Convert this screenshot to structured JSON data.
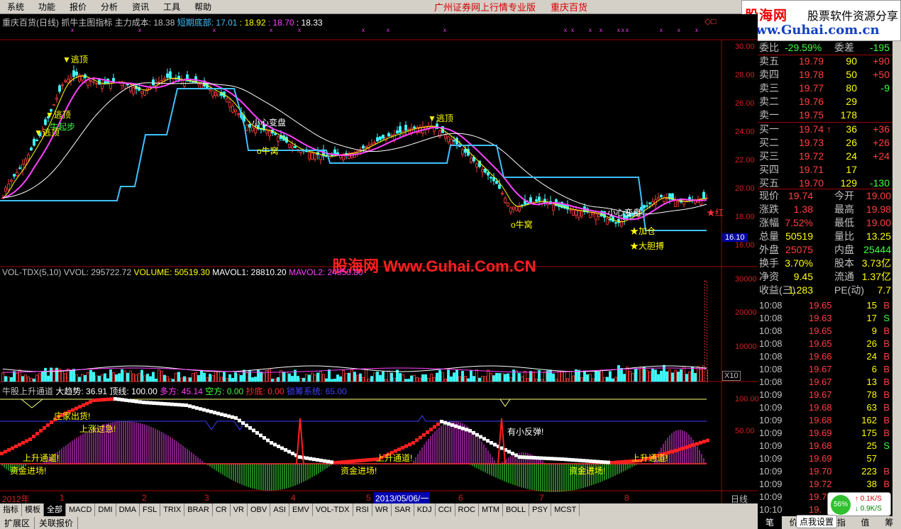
{
  "menu": {
    "items": [
      "系统",
      "功能",
      "报价",
      "分析",
      "资讯",
      "工具",
      "帮助"
    ],
    "promo": "广州证券网上行情专业版",
    "stock_name": "重庆百货"
  },
  "logo": {
    "name": "股海网",
    "slogan": "股票软件资源分享",
    "url": "www.Guhai.com.cn"
  },
  "main_title": {
    "stock": "重庆百货(日线)",
    "indicator": "抓牛主图指标",
    "cost_label": "主力成本: 18.38",
    "bottom_label": "短期底部: 17.01",
    "v1": ": 18.92",
    "v2": ": 18.70",
    "v3": ": 18.33"
  },
  "main_axis": [
    "30.00",
    "28.00",
    "26.00",
    "24.00",
    "22.00",
    "20.00",
    "18.00",
    "16.00"
  ],
  "price_tag": "16.10",
  "annotations": {
    "escape": "逃顶",
    "start": "牛起步",
    "nest": "o牛窝",
    "caution": "小心变盘",
    "add": "★加仓",
    "bold": "★大胆搏",
    "red": "红"
  },
  "watermark": "股海网 Www.Guhai.Com.CN",
  "vol_title": {
    "name": "VOL-TDX(5,10)",
    "vvol": "VVOL: 295722.72",
    "volume": "VOLUME: 50519.30",
    "mavol1": "MAVOL1: 28810.20",
    "mavol2": "MAVOL2: 24850.80"
  },
  "vol_axis": [
    "30000",
    "20000",
    "10000"
  ],
  "vol_unit": "X10",
  "ind_title": {
    "name": "牛股上升通道",
    "trend": "大趋势: 36.91",
    "top": "顶线: 100.00",
    "long": "多方: 45.14",
    "short": "空方: 0.00",
    "bottom": "抄底: 0.00",
    "lock": "锁筹系统: 65.00"
  },
  "ind_axis": [
    "100.00",
    "50.00"
  ],
  "ind_labels": {
    "dump": "庄家出货!",
    "rise_fast": "上涨过急!",
    "channel": "上升通道!",
    "inflow": "资金进场!",
    "rebound": "有小反弹!"
  },
  "xaxis": {
    "year": "2012年",
    "months": [
      "1",
      "2",
      "3",
      "4",
      "5",
      "6",
      "7",
      "8"
    ],
    "date": "2013/05/06/一",
    "period": "日线"
  },
  "quote": {
    "wb_label": "委比",
    "wb_val": "-29.59%",
    "wc_label": "委差",
    "wc_val": "-195",
    "sells": [
      [
        "卖五",
        "19.79",
        "90",
        "+90"
      ],
      [
        "卖四",
        "19.78",
        "50",
        "+50"
      ],
      [
        "卖三",
        "19.77",
        "80",
        "-9"
      ],
      [
        "卖二",
        "19.76",
        "29",
        ""
      ],
      [
        "卖一",
        "19.75",
        "178",
        ""
      ]
    ],
    "buys": [
      [
        "买一",
        "19.74",
        "36",
        "+36"
      ],
      [
        "买二",
        "19.73",
        "26",
        "+26"
      ],
      [
        "买三",
        "19.72",
        "24",
        "+24"
      ],
      [
        "买四",
        "19.71",
        "17",
        ""
      ],
      [
        "买五",
        "19.70",
        "129",
        "-130"
      ]
    ],
    "stats": [
      [
        "现价",
        "19.74",
        "今开",
        "19.00"
      ],
      [
        "涨跌",
        "1.38",
        "最高",
        "19.98"
      ],
      [
        "涨幅",
        "7.52%",
        "最低",
        "19.00"
      ],
      [
        "总量",
        "50519",
        "量比",
        "13.25"
      ],
      [
        "外盘",
        "25075",
        "内盘",
        "25444"
      ],
      [
        "换手",
        "3.70%",
        "股本",
        "3.73亿"
      ],
      [
        "净资",
        "9.45",
        "流通",
        "1.37亿"
      ],
      [
        "收益(三)",
        "1.283",
        "PE(动)",
        "7.7"
      ]
    ]
  },
  "ticks": [
    [
      "10:08",
      "19.65",
      "15",
      "B"
    ],
    [
      "10:08",
      "19.63",
      "17",
      "S"
    ],
    [
      "10:08",
      "19.65",
      "9",
      "B"
    ],
    [
      "10:08",
      "19.65",
      "26",
      "B"
    ],
    [
      "10:08",
      "19.66",
      "24",
      "B"
    ],
    [
      "10:08",
      "19.67",
      "6",
      "B"
    ],
    [
      "10:08",
      "19.67",
      "13",
      "B"
    ],
    [
      "10:09",
      "19.67",
      "78",
      "B"
    ],
    [
      "10:09",
      "19.68",
      "63",
      "B"
    ],
    [
      "10:09",
      "19.68",
      "162",
      "B"
    ],
    [
      "10:09",
      "19.69",
      "175",
      "B"
    ],
    [
      "10:09",
      "19.68",
      "25",
      "S"
    ],
    [
      "10:09",
      "19.69",
      "57",
      ""
    ],
    [
      "10:09",
      "19.70",
      "223",
      "B"
    ],
    [
      "10:09",
      "19.72",
      "38",
      "B"
    ],
    [
      "10:09",
      "19.7",
      "",
      "B"
    ],
    [
      "10:10",
      "19.",
      "",
      ""
    ]
  ],
  "gauge": {
    "pct": "56%",
    "up": "0.1K/S",
    "down": "0.9K/S"
  },
  "bottom_tabs": [
    "指标",
    "模板",
    "全部",
    "MACD",
    "DMI",
    "DMA",
    "FSL",
    "TRIX",
    "BRAR",
    "CR",
    "VR",
    "OBV",
    "ASI",
    "EMV",
    "VOL-TDX",
    "RSI",
    "WR",
    "SAR",
    "KDJ",
    "CCI",
    "ROC",
    "MTM",
    "BOLL",
    "PSY",
    "MCST"
  ],
  "status": {
    "ext": "扩展区",
    "rel": "关联报价",
    "right_tabs": [
      "笔",
      "价",
      "细",
      "指",
      "值",
      "筹"
    ],
    "settings": "点我设置"
  }
}
